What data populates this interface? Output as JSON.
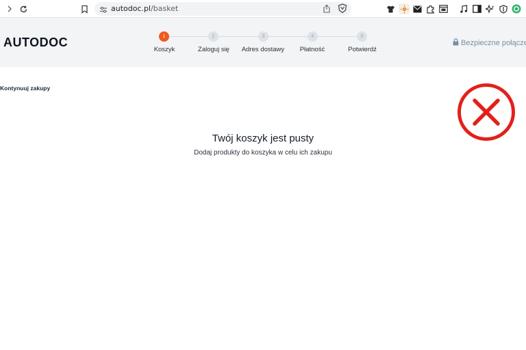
{
  "browser": {
    "url_host": "autodoc.pl",
    "url_path": "/basket"
  },
  "icons": {
    "forward": "chevron-right-icon",
    "reload": "reload-icon",
    "bookmark": "bookmark-icon",
    "site_settings": "tune-icon",
    "share": "share-icon",
    "brave": "brave-shield-icon",
    "lock": "lock-icon"
  },
  "header": {
    "logo": "AUTODOC",
    "secure_label": "Bezpieczne połącze"
  },
  "steps": [
    {
      "number": "1",
      "label": "Koszyk",
      "active": true
    },
    {
      "number": "2",
      "label": "Zaloguj się",
      "active": false
    },
    {
      "number": "3",
      "label": "Adres dostawy",
      "active": false
    },
    {
      "number": "4",
      "label": "Płatność",
      "active": false
    },
    {
      "number": "5",
      "label": "Potwierdź",
      "active": false
    }
  ],
  "content": {
    "continue_label": "Kontynuuj zakupy",
    "empty_title": "Twój koszyk jest pusty",
    "empty_subtitle": "Dodaj produkty do koszyka w celu ich zakupu"
  },
  "colors": {
    "accent": "#f05a1e",
    "error": "#e3201b",
    "header_bg": "#f2f4f5"
  }
}
